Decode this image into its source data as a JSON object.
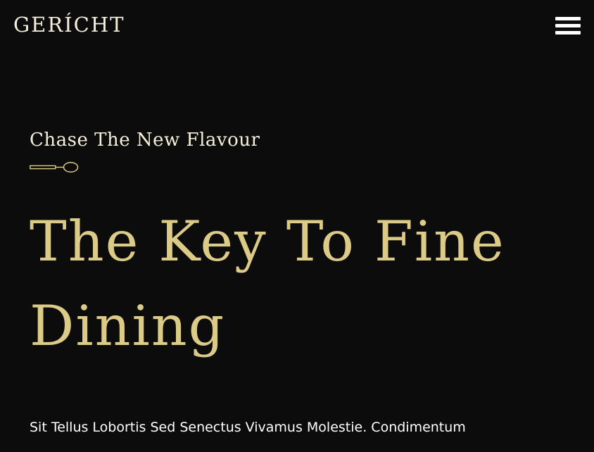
{
  "navbar": {
    "logo": "GERÍCHT",
    "menu_icon": "hamburger-menu-icon"
  },
  "hero": {
    "subtitle": "Chase The New Flavour",
    "divider_icon": "spoon-icon",
    "headline": "The Key To Fine Dining",
    "paragraph": "Sit Tellus Lobortis Sed Senectus Vivamus Molestie. Condimentum"
  },
  "colors": {
    "background": "#0c0c0c",
    "accent_gold": "#dcca87",
    "text_cream": "#f5efdb",
    "text_white": "#ffffff"
  }
}
